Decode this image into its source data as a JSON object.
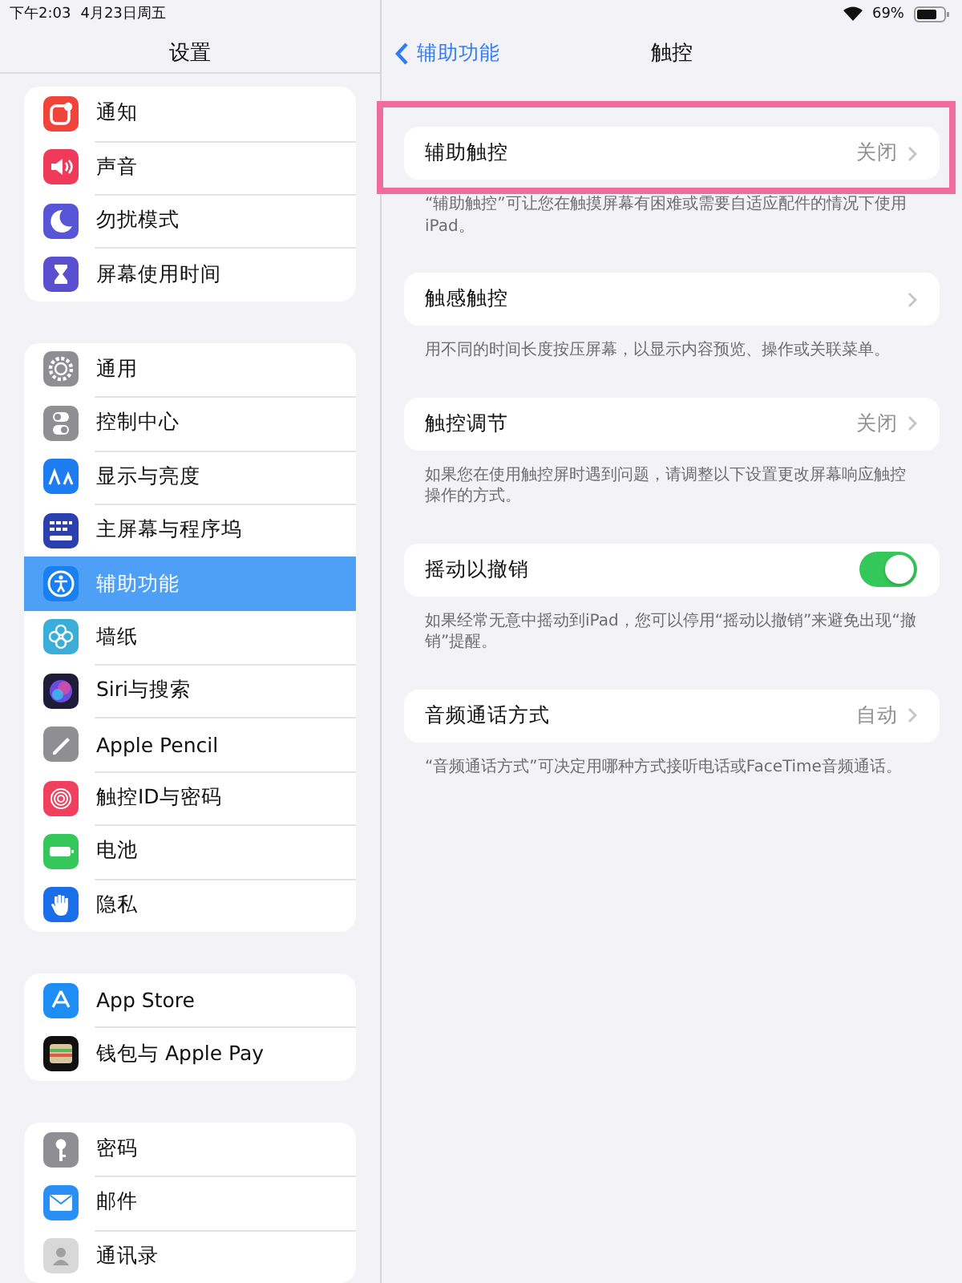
{
  "status_bar": {
    "time": "下午2:03",
    "date": "4月23日周五",
    "battery_text": "69%"
  },
  "sidebar": {
    "title": "设置",
    "groups": [
      {
        "items": [
          {
            "label": "通知",
            "color": "#f0443a",
            "selected": false
          },
          {
            "label": "声音",
            "color": "#f03a5a",
            "selected": false
          },
          {
            "label": "勿扰模式",
            "color": "#5856d6",
            "selected": false
          },
          {
            "label": "屏幕使用时间",
            "color": "#5a4fcf",
            "selected": false
          }
        ]
      },
      {
        "items": [
          {
            "label": "通用",
            "color": "#8e8e93",
            "selected": false
          },
          {
            "label": "控制中心",
            "color": "#8e8e93",
            "selected": false
          },
          {
            "label": "显示与亮度",
            "color": "#1c7cf0",
            "selected": false
          },
          {
            "label": "主屏幕与程序坞",
            "color": "#2b3fae",
            "selected": false
          },
          {
            "label": "辅助功能",
            "color": "#1a7ff0",
            "selected": true
          },
          {
            "label": "墙纸",
            "color": "#3aaed8",
            "selected": false
          },
          {
            "label": "Siri与搜索",
            "color": "#1d1d3a",
            "selected": false
          },
          {
            "label": "Apple Pencil",
            "color": "#8e8e93",
            "selected": false
          },
          {
            "label": "触控ID与密码",
            "color": "#f0405e",
            "selected": false
          },
          {
            "label": "电池",
            "color": "#34c759",
            "selected": false
          },
          {
            "label": "隐私",
            "color": "#1a6ee8",
            "selected": false
          }
        ]
      },
      {
        "items": [
          {
            "label": "App Store",
            "color": "#1e8ef5",
            "selected": false
          },
          {
            "label": "钱包与 Apple Pay",
            "color": "#111111",
            "selected": false
          }
        ]
      },
      {
        "items": [
          {
            "label": "密码",
            "color": "#8e8e93",
            "selected": false
          },
          {
            "label": "邮件",
            "color": "#2a8ff5",
            "selected": false
          },
          {
            "label": "通讯录",
            "color": "#d8d8d8",
            "selected": false
          }
        ]
      }
    ]
  },
  "detail": {
    "back_label": "辅助功能",
    "title": "触控",
    "sections": [
      {
        "kind": "link",
        "label": "辅助触控",
        "value": "关闭",
        "highlighted": true,
        "footer": "“辅助触控”可让您在触摸屏幕有困难或需要自适应配件的情况下使用iPad。"
      },
      {
        "kind": "link",
        "label": "触感触控",
        "highlighted": false,
        "footer": "用不同的时间长度按压屏幕，以显示内容预览、操作或关联菜单。"
      },
      {
        "kind": "link",
        "label": "触控调节",
        "value": "关闭",
        "highlighted": false,
        "footer": "如果您在使用触控屏时遇到问题，请调整以下设置更改屏幕响应触控操作的方式。"
      },
      {
        "kind": "toggle",
        "label": "摇动以撤销",
        "on": true,
        "highlighted": false,
        "footer": "如果经常无意中摇动到iPad，您可以停用“摇动以撤销”来避免出现“撤销”提醒。"
      },
      {
        "kind": "link",
        "label": "音频通话方式",
        "value": "自动",
        "highlighted": false,
        "footer": "“音频通话方式”可决定用哪种方式接听电话或FaceTime音频通话。"
      }
    ]
  }
}
